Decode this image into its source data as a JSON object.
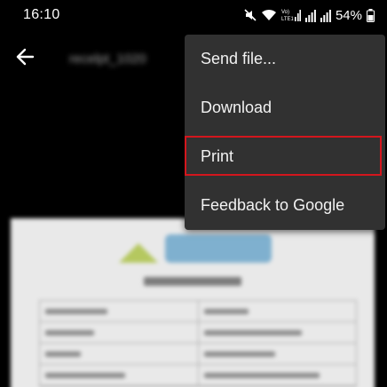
{
  "status_bar": {
    "time": "16:10",
    "network_label": "VoLTE1",
    "battery_percent": "54%",
    "icons": [
      "mute-icon",
      "wifi-icon",
      "volte-signal-icon",
      "signal-icon",
      "signal-icon",
      "battery-icon"
    ]
  },
  "app_bar": {
    "back_icon": "arrow-left-icon",
    "file_title": "recelpt_1020"
  },
  "menu": {
    "items": [
      {
        "label": "Send file..."
      },
      {
        "label": "Download"
      },
      {
        "label": "Print",
        "highlighted": true
      },
      {
        "label": "Feedback to Google"
      }
    ]
  },
  "colors": {
    "background": "#000000",
    "menu_background": "#313131",
    "menu_text": "#f2f2f2",
    "highlight": "#d3161d",
    "document": "#e9e9e9"
  }
}
